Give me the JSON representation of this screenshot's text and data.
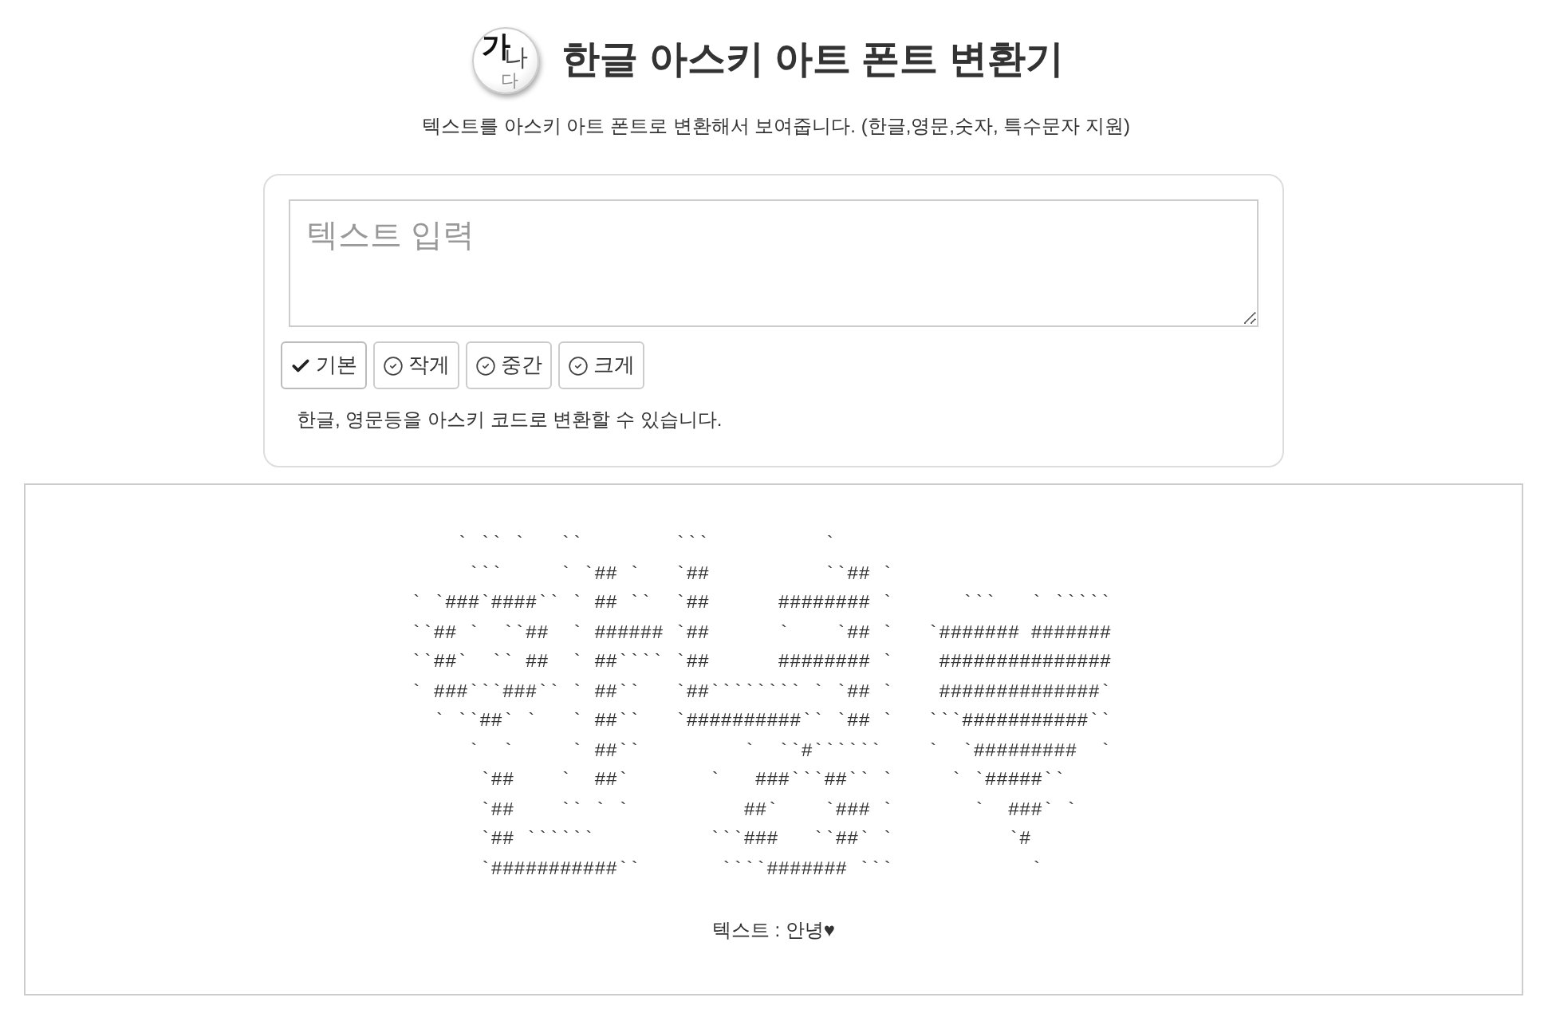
{
  "header": {
    "logo_chars": [
      "가",
      "나",
      "다"
    ],
    "title": "한글 아스키 아트 폰트 변환기",
    "subtitle": "텍스트를 아스키 아트 폰트로 변환해서 보여줍니다. (한글,영문,숫자, 특수문자 지원)"
  },
  "form": {
    "input": {
      "placeholder": "텍스트 입력"
    },
    "size_options": [
      {
        "label": "기본",
        "selected": true
      },
      {
        "label": "작게",
        "selected": false
      },
      {
        "label": "중간",
        "selected": false
      },
      {
        "label": "크게",
        "selected": false
      }
    ],
    "hint": "한글, 영문등을 아스키 코드로 변환할 수 있습니다."
  },
  "result": {
    "ascii_art": [
      "    ` `` `   ``        ```          `",
      "     ```     ` `## `   `##          ``## `",
      "` `###`####`` ` ## ``  `##      ######## `      ```   ` `````",
      "``## `  ``##  ` ###### `##      `    `## `   `####### #######",
      "``##`  `` ##  ` ##```` `##      ######## `    ###############",
      "` ###```###`` ` ##``   `##```````` ` `## `    ##############`",
      "  ` ``##` `   ` ##``   `##########`` `## `   ```###########``",
      "     `  `     ` ##``         `  ``#``````    `  `#########  `",
      "      `##    `  ##`       `   ###```##`` `     ` `#####``",
      "      `##    `` ` `          ##`    `### `       `  ###` `",
      "      `## ``````          ```###   ``##` `          `#",
      "      `###########``       ````####### ```            `"
    ],
    "caption": "텍스트 : 안녕♥"
  }
}
